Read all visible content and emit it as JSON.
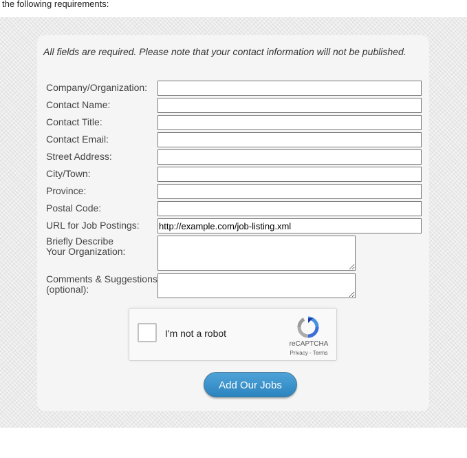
{
  "header": {
    "intro_text": "the following requirements:"
  },
  "form": {
    "note": "All fields are required. Please note that your contact information will not be published.",
    "fields": [
      {
        "label": "Company/Organization:",
        "value": ""
      },
      {
        "label": "Contact Name:",
        "value": ""
      },
      {
        "label": "Contact Title:",
        "value": ""
      },
      {
        "label": "Contact Email:",
        "value": ""
      },
      {
        "label": "Street Address:",
        "value": ""
      },
      {
        "label": "City/Town:",
        "value": ""
      },
      {
        "label": "Province:",
        "value": ""
      },
      {
        "label": "Postal Code:",
        "value": ""
      },
      {
        "label": "URL for Job Postings:",
        "value": "http://example.com/job-listing.xml"
      }
    ],
    "describe": {
      "line1": "Briefly Describe",
      "line2": "Your Organization:",
      "value": ""
    },
    "comments": {
      "line1": "Comments & Suggestions",
      "line2": "(optional):",
      "value": ""
    },
    "submit_label": "Add Our Jobs"
  },
  "captcha": {
    "label": "I'm not a robot",
    "brand": "reCAPTCHA",
    "links": "Privacy - Terms",
    "checked": false
  },
  "colors": {
    "button": "#2f8ac8",
    "card": "#f5f5f5",
    "background": "#ebebeb"
  }
}
